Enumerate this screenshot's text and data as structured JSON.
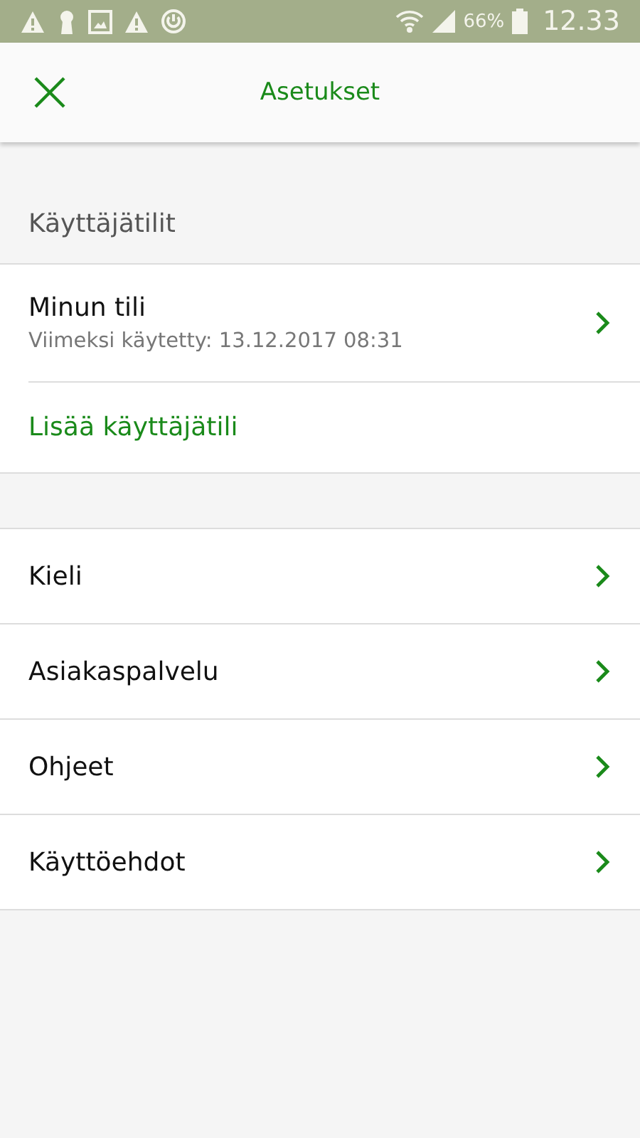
{
  "status_bar": {
    "battery_percent": "66%",
    "time": "12.33"
  },
  "app_bar": {
    "title": "Asetukset"
  },
  "accounts": {
    "header": "Käyttäjätilit",
    "items": [
      {
        "title": "Minun tili",
        "subtitle": "Viimeksi käytetty: 13.12.2017 08:31"
      }
    ],
    "add_link": "Lisää käyttäjätili"
  },
  "menu": [
    {
      "label": "Kieli"
    },
    {
      "label": "Asiakaspalvelu"
    },
    {
      "label": "Ohjeet"
    },
    {
      "label": "Käyttöehdot"
    }
  ]
}
